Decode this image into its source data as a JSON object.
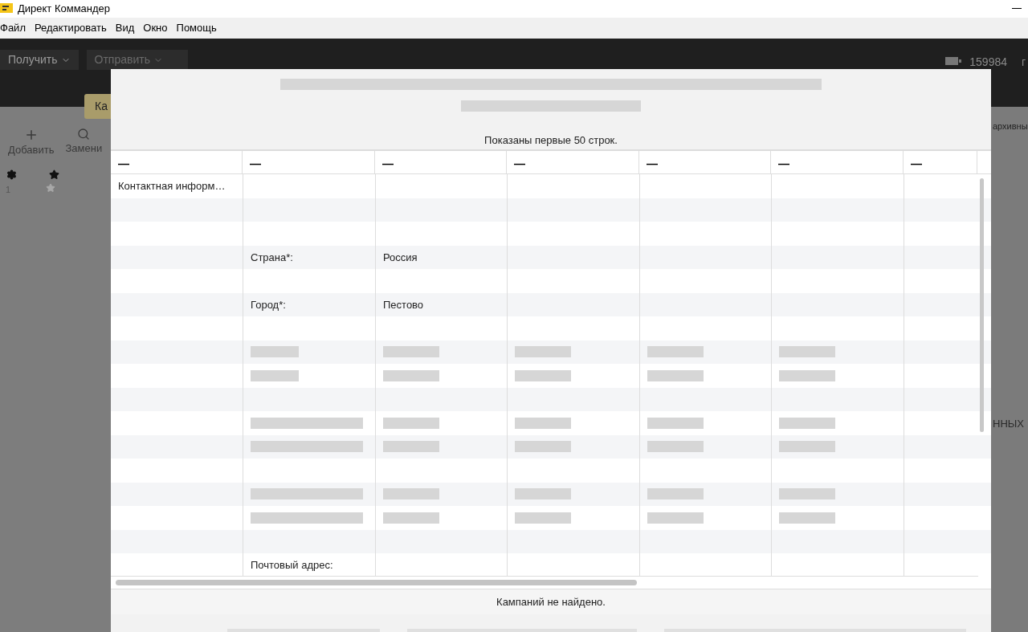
{
  "window": {
    "title": "Директ Коммандер"
  },
  "menu": [
    "Файл",
    "Редактировать",
    "Вид",
    "Окно",
    "Помощь"
  ],
  "toolbar": {
    "buttons": [
      {
        "label": "Получить",
        "disabled": false
      },
      {
        "label": "Отправить",
        "disabled": true
      }
    ],
    "balance": "159984",
    "cut_label": "г"
  },
  "tooltip": "Ка",
  "side_panel": {
    "actions": [
      "Добавить",
      "Замени"
    ],
    "row_number": "1",
    "right_texts": [
      "архивны",
      "ННЫХ"
    ]
  },
  "dialog": {
    "note": "Показаны первые 50 строк.",
    "columns": [
      "—",
      "—",
      "—",
      "—",
      "—",
      "—",
      "—"
    ],
    "rows": [
      {
        "kind": "text",
        "column_1": "Контактная информ…"
      },
      {
        "kind": "text"
      },
      {
        "kind": "text"
      },
      {
        "kind": "text",
        "column_2": "Страна*:",
        "column_3": "Россия"
      },
      {
        "kind": "text"
      },
      {
        "kind": "text",
        "column_2": "Город*:",
        "column_3": "Пестово"
      },
      {
        "kind": "text"
      },
      {
        "kind": "redacted"
      },
      {
        "kind": "redacted"
      },
      {
        "kind": "text"
      },
      {
        "kind": "redacted"
      },
      {
        "kind": "redacted"
      },
      {
        "kind": "text"
      },
      {
        "kind": "redacted"
      },
      {
        "kind": "redacted"
      },
      {
        "kind": "text"
      },
      {
        "kind": "text",
        "column_2": "Почтовый адрес:"
      }
    ],
    "status": "Кампаний не найдено."
  }
}
